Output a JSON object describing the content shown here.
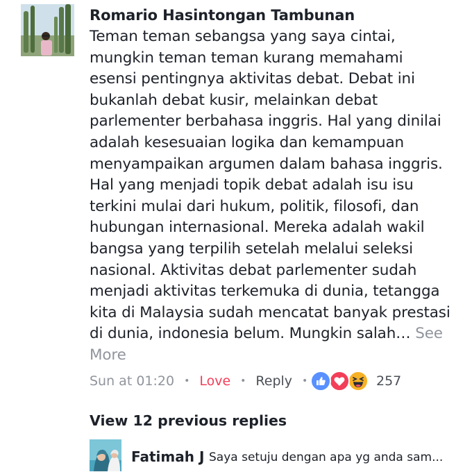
{
  "comment": {
    "author": "Romario Hasintongan Tambunan",
    "lines": [
      "Teman teman sebangsa yang saya cintai,",
      "mungkin teman teman kurang memahami",
      "esensi pentingnya aktivitas debat. Debat ini",
      "bukanlah debat kusir, melainkan debat",
      "parlementer berbahasa inggris. Hal yang dinilai",
      "adalah kesesuaian logika dan kemampuan",
      "menyampaikan argumen dalam bahasa inggris.",
      "Hal yang menjadi topik debat adalah isu isu",
      "terkini mulai dari hukum, politik, filosofi, dan",
      "hubungan internasional. Mereka adalah wakil",
      "bangsa yang terpilih setelah melalui seleksi",
      "nasional. Aktivitas debat parlementer sudah",
      "menjadi aktivitas terkemuka di dunia, tetangga",
      "kita di Malaysia sudah mencatat banyak prestasi",
      "di dunia, indonesia belum. Mungkin salah…"
    ],
    "see_more": "See More",
    "time": "Sun at 01:20",
    "love_label": "Love",
    "reply_label": "Reply",
    "reaction_icons": [
      "like-icon",
      "love-icon",
      "haha-icon"
    ],
    "reaction_count": "257",
    "colors": {
      "love": "#f33e58",
      "like": "#5890ff",
      "muted": "#90949c",
      "haha": "#f7b125"
    }
  },
  "replies": {
    "view_previous": "View 12 previous replies",
    "items": [
      {
        "author": "Fatimah J",
        "text": "Saya setuju dengan apa yg anda sam..."
      }
    ]
  }
}
